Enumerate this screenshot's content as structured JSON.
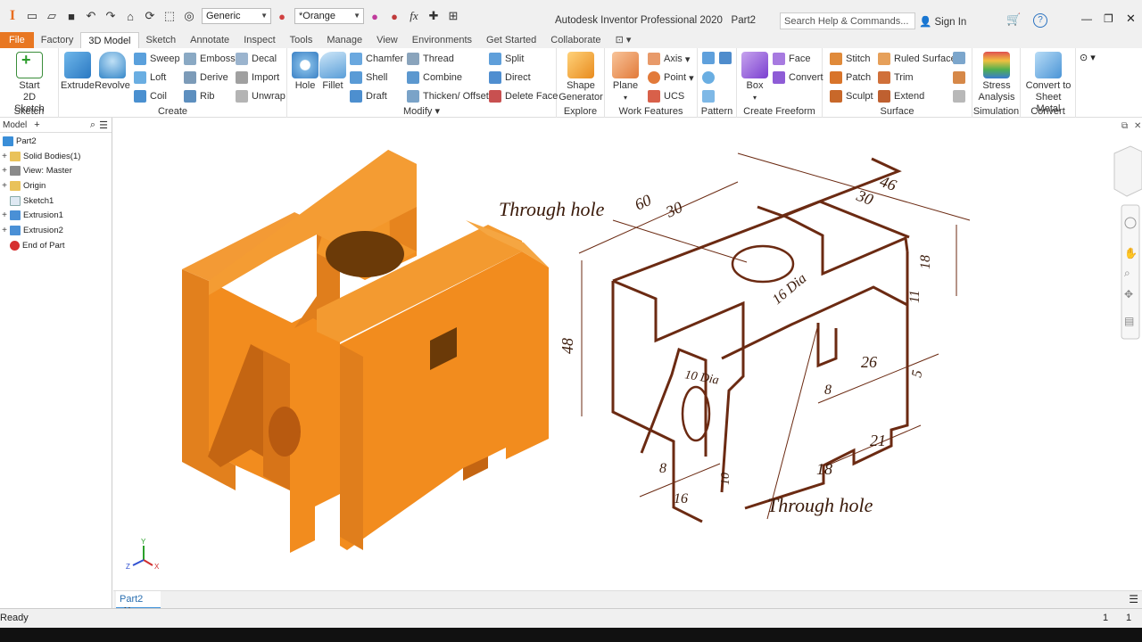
{
  "app": {
    "title": "Autodesk Inventor Professional 2020",
    "document": "Part2",
    "search_placeholder": "Search Help & Commands...",
    "sign_in": "Sign In",
    "material": "Generic",
    "appearance": "*Orange"
  },
  "tabs": [
    "File",
    "Factory",
    "3D Model",
    "Sketch",
    "Annotate",
    "Inspect",
    "Tools",
    "Manage",
    "View",
    "Environments",
    "Get Started",
    "Collaborate"
  ],
  "ribbon": {
    "sketch": {
      "start_line1": "Start",
      "start_line2": "2D Sketch",
      "label": "Sketch"
    },
    "create": {
      "extrude": "Extrude",
      "revolve": "Revolve",
      "sweep": "Sweep",
      "loft": "Loft",
      "coil": "Coil",
      "emboss": "Emboss",
      "derive": "Derive",
      "rib": "Rib",
      "decal": "Decal",
      "import": "Import",
      "unwrap": "Unwrap",
      "label": "Create"
    },
    "modify": {
      "hole": "Hole",
      "fillet": "Fillet",
      "chamfer": "Chamfer",
      "shell": "Shell",
      "draft": "Draft",
      "thread": "Thread",
      "combine": "Combine",
      "thicken": "Thicken/ Offset",
      "split": "Split",
      "direct": "Direct",
      "delete_face": "Delete Face",
      "label": "Modify"
    },
    "explore": {
      "shape_line1": "Shape",
      "shape_line2": "Generator",
      "label": "Explore"
    },
    "work": {
      "plane": "Plane",
      "axis": "Axis",
      "point": "Point",
      "ucs": "UCS",
      "label": "Work Features"
    },
    "pattern": {
      "label": "Pattern"
    },
    "freeform": {
      "box": "Box",
      "face": "Face",
      "convert": "Convert",
      "label": "Create Freeform"
    },
    "surface": {
      "stitch": "Stitch",
      "patch": "Patch",
      "sculpt": "Sculpt",
      "ruled": "Ruled Surface",
      "trim": "Trim",
      "extend": "Extend",
      "label": "Surface"
    },
    "simulation": {
      "stress_line1": "Stress",
      "stress_line2": "Analysis",
      "label": "Simulation"
    },
    "convert": {
      "sheet_line1": "Convert to",
      "sheet_line2": "Sheet Metal",
      "label": "Convert"
    }
  },
  "browser": {
    "title": "Model",
    "root": "Part2",
    "items": [
      {
        "label": "Solid Bodies(1)",
        "expandable": true,
        "icon": "folder-icon"
      },
      {
        "label": "View: Master",
        "expandable": true,
        "icon": "view-icon"
      },
      {
        "label": "Origin",
        "expandable": true,
        "icon": "folder-icon"
      },
      {
        "label": "Sketch1",
        "expandable": false,
        "icon": "sketch-icon"
      },
      {
        "label": "Extrusion1",
        "expandable": true,
        "icon": "extrusion-icon"
      },
      {
        "label": "Extrusion2",
        "expandable": true,
        "icon": "extrusion-icon"
      },
      {
        "label": "End of Part",
        "expandable": false,
        "icon": "end-of-part-icon"
      }
    ]
  },
  "drawing": {
    "labels": [
      "Through hole",
      "60",
      "30",
      "46",
      "30",
      "16 Dia",
      "18",
      "11",
      "48",
      "10 Dia",
      "26",
      "8",
      "5",
      "21",
      "18",
      "8",
      "16",
      "10",
      "Through hole"
    ]
  },
  "triad": {
    "x": "X",
    "y": "Y",
    "z": "Z"
  },
  "doc_tab": "Part2",
  "status": {
    "text": "Ready",
    "count1": "1",
    "count2": "1"
  },
  "colors": {
    "accent": "#e87722",
    "part_orange": "#f28c1e",
    "part_dark": "#c86a10",
    "sketch_ink": "#6b2a12"
  }
}
